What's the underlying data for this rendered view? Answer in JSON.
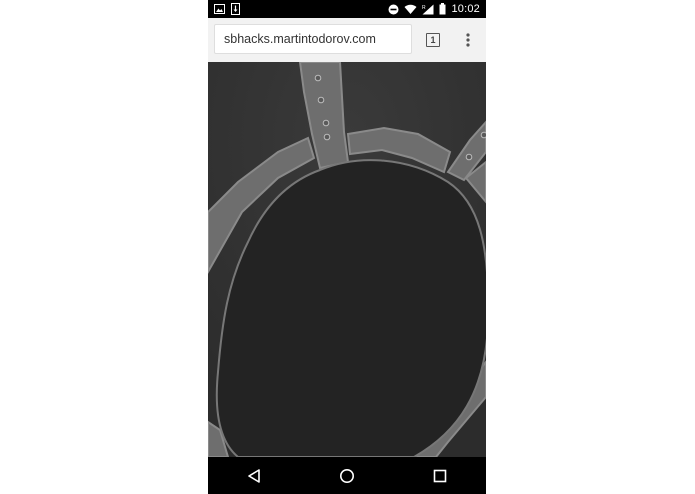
{
  "status_bar": {
    "time": "10:02",
    "icons": [
      "image-notification-icon",
      "download-notification-icon",
      "do-not-disturb-icon",
      "wifi-icon",
      "signal-icon",
      "battery-icon"
    ]
  },
  "browser": {
    "url": "sbhacks.martintodorov.com",
    "tab_count": "1",
    "menu_icon": "more-vert-icon"
  },
  "map": {
    "theme": "dark",
    "colors": {
      "background": "#303030",
      "block": "#232323",
      "road": "#6e6e6e",
      "road_border": "#8a8a8a"
    }
  },
  "nav_bar": {
    "buttons": [
      "back-icon",
      "home-icon",
      "recents-icon"
    ]
  }
}
